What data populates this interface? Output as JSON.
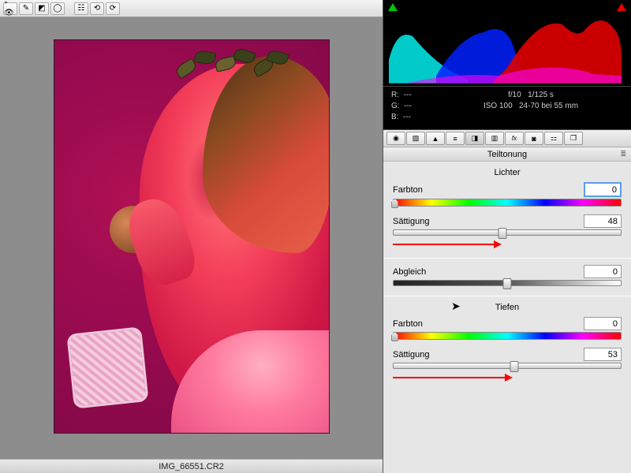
{
  "filename": "IMG_66551.CR2",
  "meta": {
    "r_label": "R:",
    "r_val": "---",
    "g_label": "G:",
    "g_val": "---",
    "b_label": "B:",
    "b_val": "---",
    "aperture": "f/10",
    "shutter": "1/125 s",
    "iso": "ISO 100",
    "lens": "24-70 bei 55 mm"
  },
  "panel": {
    "title": "Teiltonung",
    "highlights_title": "Lichter",
    "hue_label": "Farbton",
    "sat_label": "Sättigung",
    "balance_label": "Abgleich",
    "shadows_title": "Tiefen",
    "highlights_hue": "0",
    "highlights_sat": "48",
    "balance": "0",
    "shadows_hue": "0",
    "shadows_sat": "53"
  },
  "sliders": {
    "highlights_sat_pct": 48,
    "balance_pct": 50,
    "shadows_sat_pct": 53
  }
}
